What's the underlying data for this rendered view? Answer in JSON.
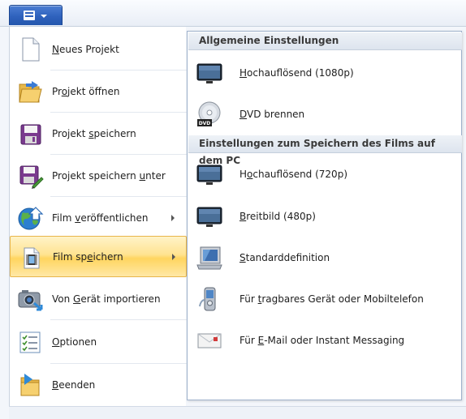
{
  "app_menu": {
    "button_icon": "document-menu-icon",
    "caret_icon": "caret-down-icon"
  },
  "menu": {
    "items": [
      {
        "pre": "",
        "key": "N",
        "post": "eues Projekt",
        "icon": "new-project-icon"
      },
      {
        "pre": "Pr",
        "key": "o",
        "post": "jekt öffnen",
        "icon": "open-folder-icon"
      },
      {
        "pre": "Projekt ",
        "key": "s",
        "post": "peichern",
        "icon": "save-disk-icon"
      },
      {
        "pre": "Projekt speichern ",
        "key": "u",
        "post": "nter",
        "icon": "save-as-icon"
      },
      {
        "pre": "Film ",
        "key": "v",
        "post": "eröffentlichen",
        "icon": "publish-globe-icon",
        "submenu": true
      },
      {
        "pre": "Film sp",
        "key": "e",
        "post": "ichern",
        "icon": "film-save-icon",
        "submenu": true,
        "selected": true
      },
      {
        "pre": "Von ",
        "key": "G",
        "post": "erät importieren",
        "icon": "camera-import-icon"
      },
      {
        "pre": "",
        "key": "O",
        "post": "ptionen",
        "icon": "options-checklist-icon"
      },
      {
        "pre": "",
        "key": "B",
        "post": "eenden",
        "icon": "exit-icon"
      }
    ]
  },
  "submenu": {
    "header1": "Allgemeine Einstellungen",
    "header2": "Einstellungen zum Speichern des Films auf dem PC",
    "group1": [
      {
        "pre": "",
        "key": "H",
        "post": "ochauflösend (1080p)",
        "icon": "monitor-icon"
      },
      {
        "pre": "",
        "key": "D",
        "post": "VD brennen",
        "icon": "dvd-disc-icon",
        "badge": "DVD"
      }
    ],
    "group2": [
      {
        "pre": "H",
        "key": "o",
        "post": "chauflösend (720p)",
        "icon": "monitor-icon"
      },
      {
        "pre": "",
        "key": "B",
        "post": "reitbild (480p)",
        "icon": "monitor-icon"
      },
      {
        "pre": "",
        "key": "S",
        "post": "tandarddefinition",
        "icon": "crt-monitor-icon"
      },
      {
        "pre": "Für ",
        "key": "t",
        "post": "ragbares Gerät oder Mobiltelefon",
        "icon": "mobile-phone-icon"
      },
      {
        "pre": "Für ",
        "key": "E",
        "post": "-Mail oder Instant Messaging",
        "icon": "email-envelope-icon"
      }
    ]
  }
}
